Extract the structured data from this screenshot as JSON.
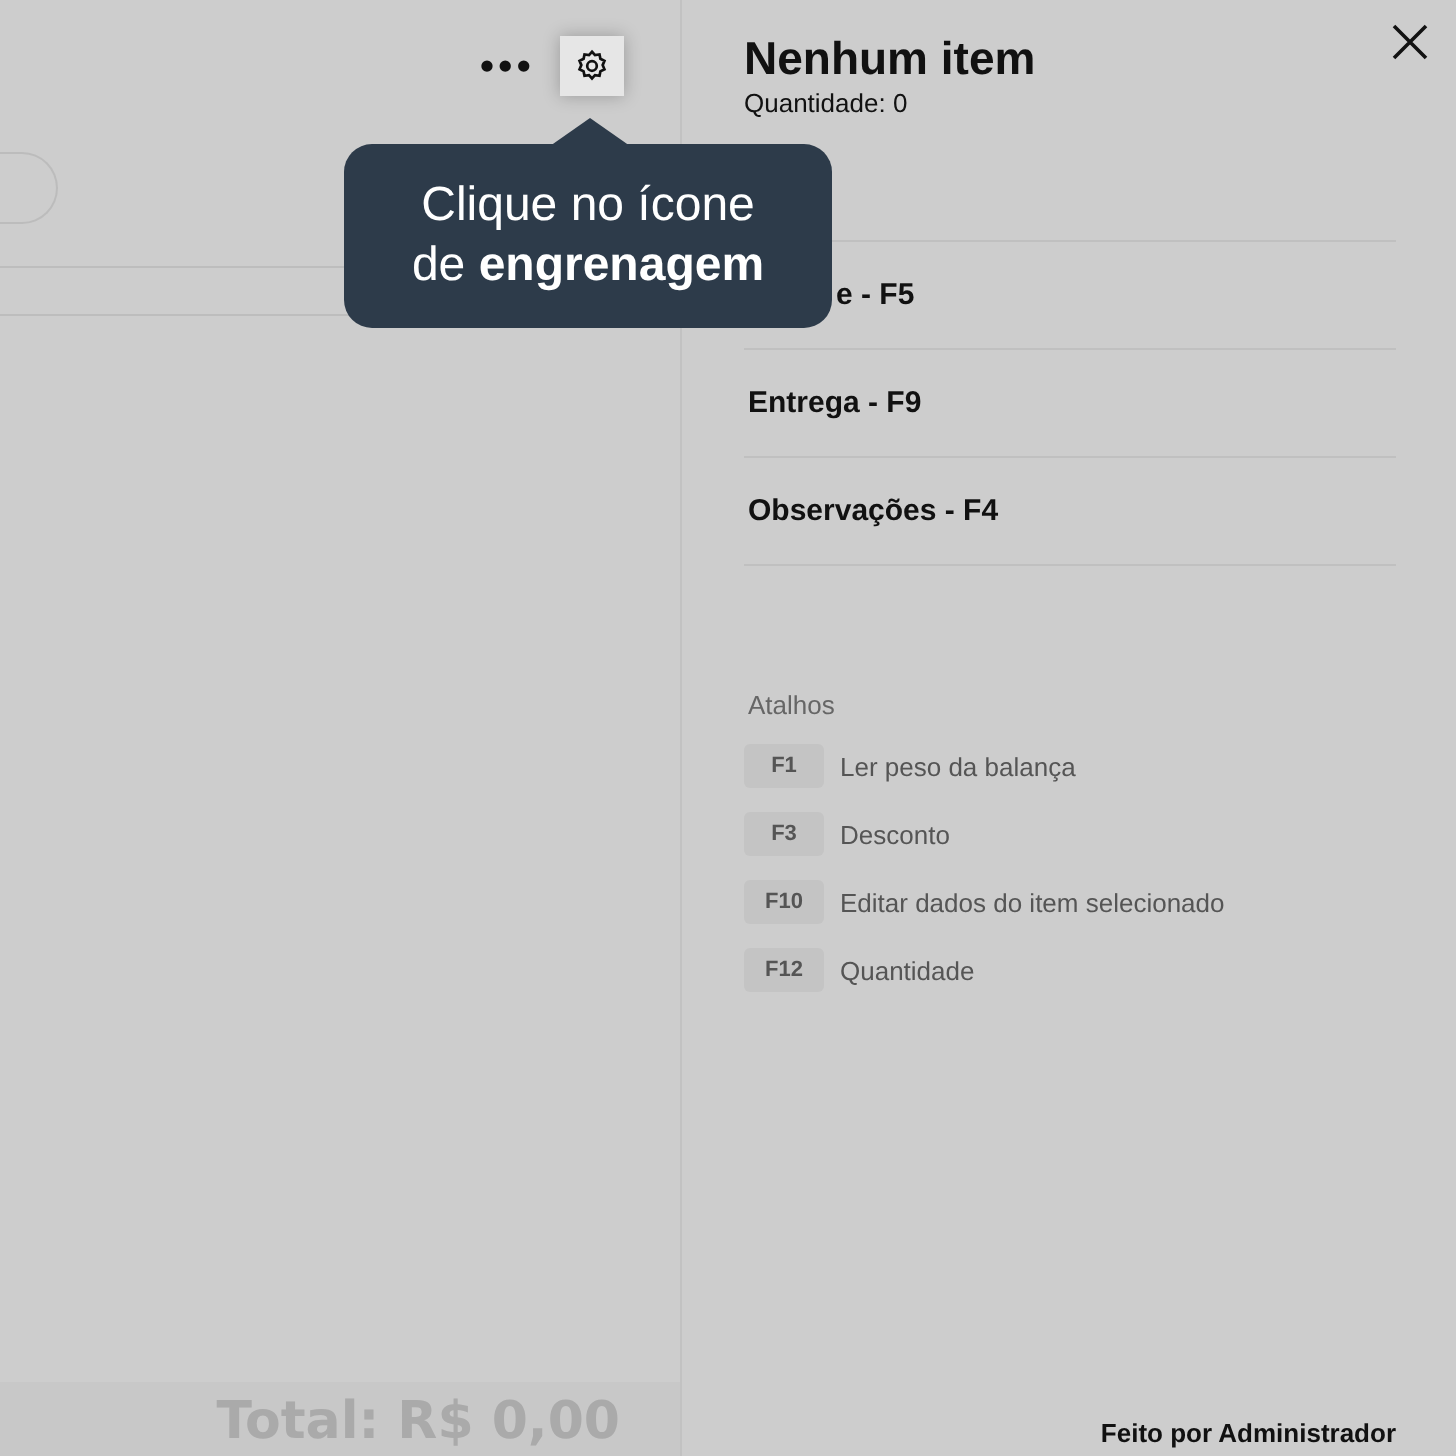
{
  "toolbar": {
    "more": "•••"
  },
  "tooltip": {
    "text": "Clique no ícone de **engrenagem**"
  },
  "panel": {
    "title": "Nenhum item",
    "subtitle": "Quantidade: 0",
    "sections": [
      {
        "label": "e - F5",
        "covered": true
      },
      {
        "label": "Entrega - F9",
        "covered": false
      },
      {
        "label": "Observações - F4",
        "covered": false
      }
    ],
    "shortcuts_title": "Atalhos",
    "shortcuts": [
      {
        "key": "F1",
        "label": "Ler peso da balança"
      },
      {
        "key": "F3",
        "label": "Desconto"
      },
      {
        "key": "F10",
        "label": "Editar dados do item selecionado"
      },
      {
        "key": "F12",
        "label": "Quantidade"
      }
    ],
    "footer": "Feito por Administrador"
  },
  "total": "Total: R$ 0,00"
}
